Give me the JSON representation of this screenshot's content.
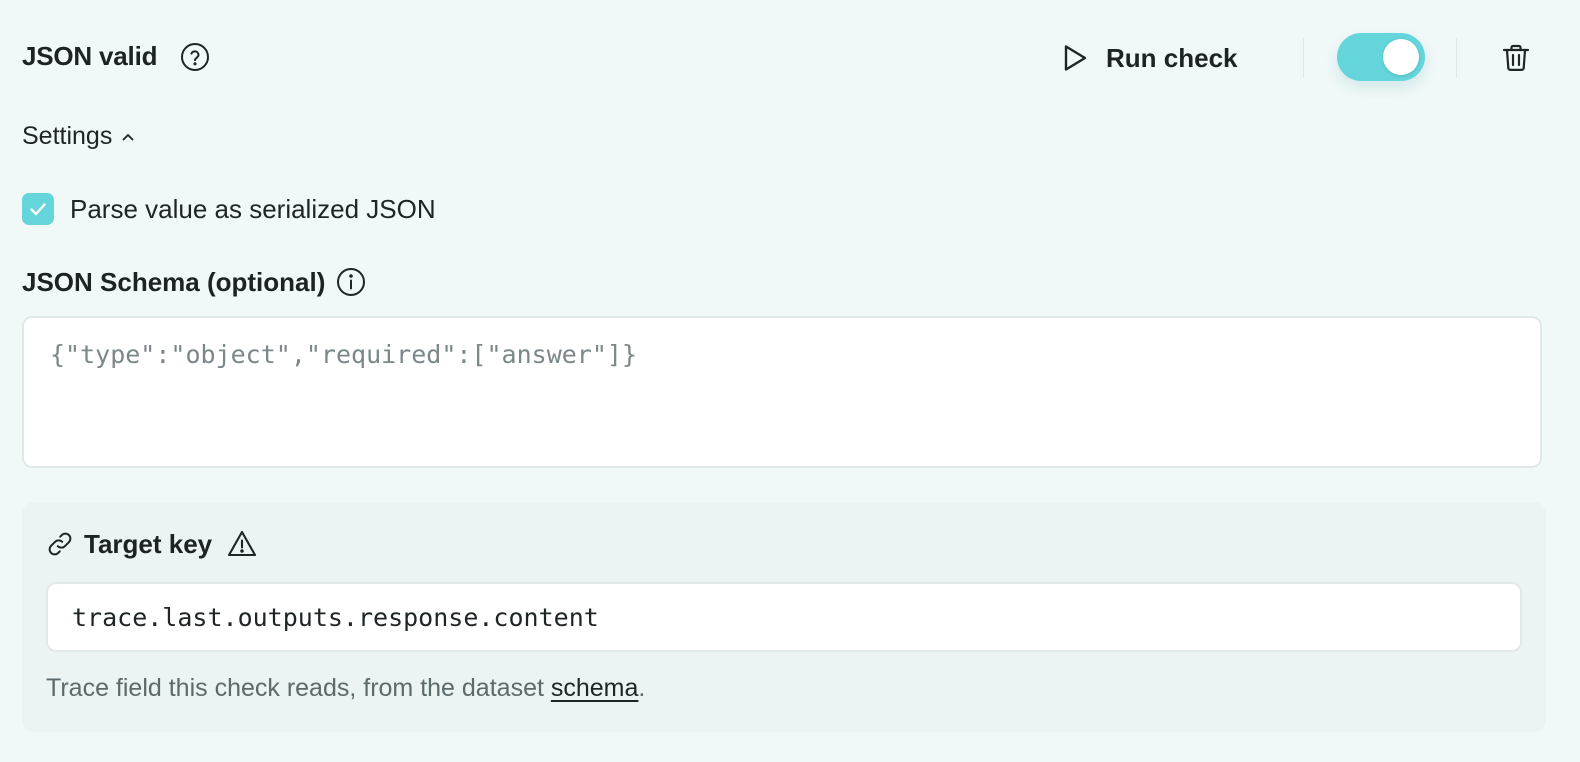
{
  "header": {
    "title": "JSON valid",
    "run_check_label": "Run check",
    "toggle_on": true,
    "accent_color": "#64d5da"
  },
  "settings": {
    "label": "Settings",
    "expanded": true
  },
  "parse_option": {
    "label": "Parse value as serialized JSON",
    "checked": true
  },
  "schema": {
    "label": "JSON Schema (optional)",
    "placeholder": "{\"type\":\"object\",\"required\":[\"answer\"]}"
  },
  "target": {
    "label": "Target key",
    "value": "trace.last.outputs.response.content",
    "hint_prefix": "Trace field this check reads, from the dataset ",
    "hint_link": "schema",
    "hint_suffix": "."
  },
  "icons": {
    "help": "help-circle-icon",
    "run": "play-icon",
    "delete": "trash-icon",
    "collapse": "chevron-up-icon",
    "check": "check-icon",
    "info": "info-icon",
    "link": "link-icon",
    "warning": "warning-triangle-icon"
  }
}
